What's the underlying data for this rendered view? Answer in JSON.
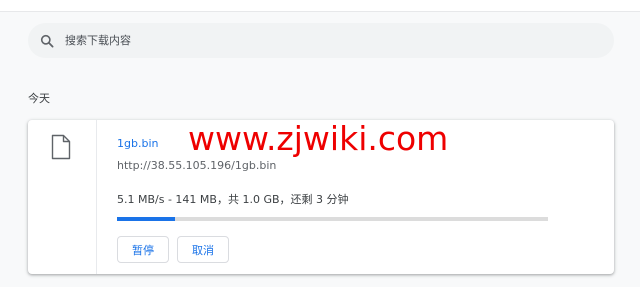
{
  "search": {
    "placeholder": "搜索下载内容",
    "icon": "search-icon"
  },
  "section": {
    "date_label": "今天"
  },
  "download": {
    "file_name": "1gb.bin",
    "url": "http://38.55.105.196/1gb.bin",
    "status": "5.1 MB/s - 141 MB，共 1.0 GB，还剩 3 分钟",
    "progress_percent": 13.5,
    "file_icon": "file-icon",
    "pause_label": "暂停",
    "cancel_label": "取消"
  },
  "watermark": "www.zjwiki.com",
  "colors": {
    "accent": "#1a73e8",
    "watermark": "#ee0000",
    "page_background": "#f8f9fa",
    "search_background": "#f1f3f4",
    "progress_track": "#dcdcdc"
  }
}
